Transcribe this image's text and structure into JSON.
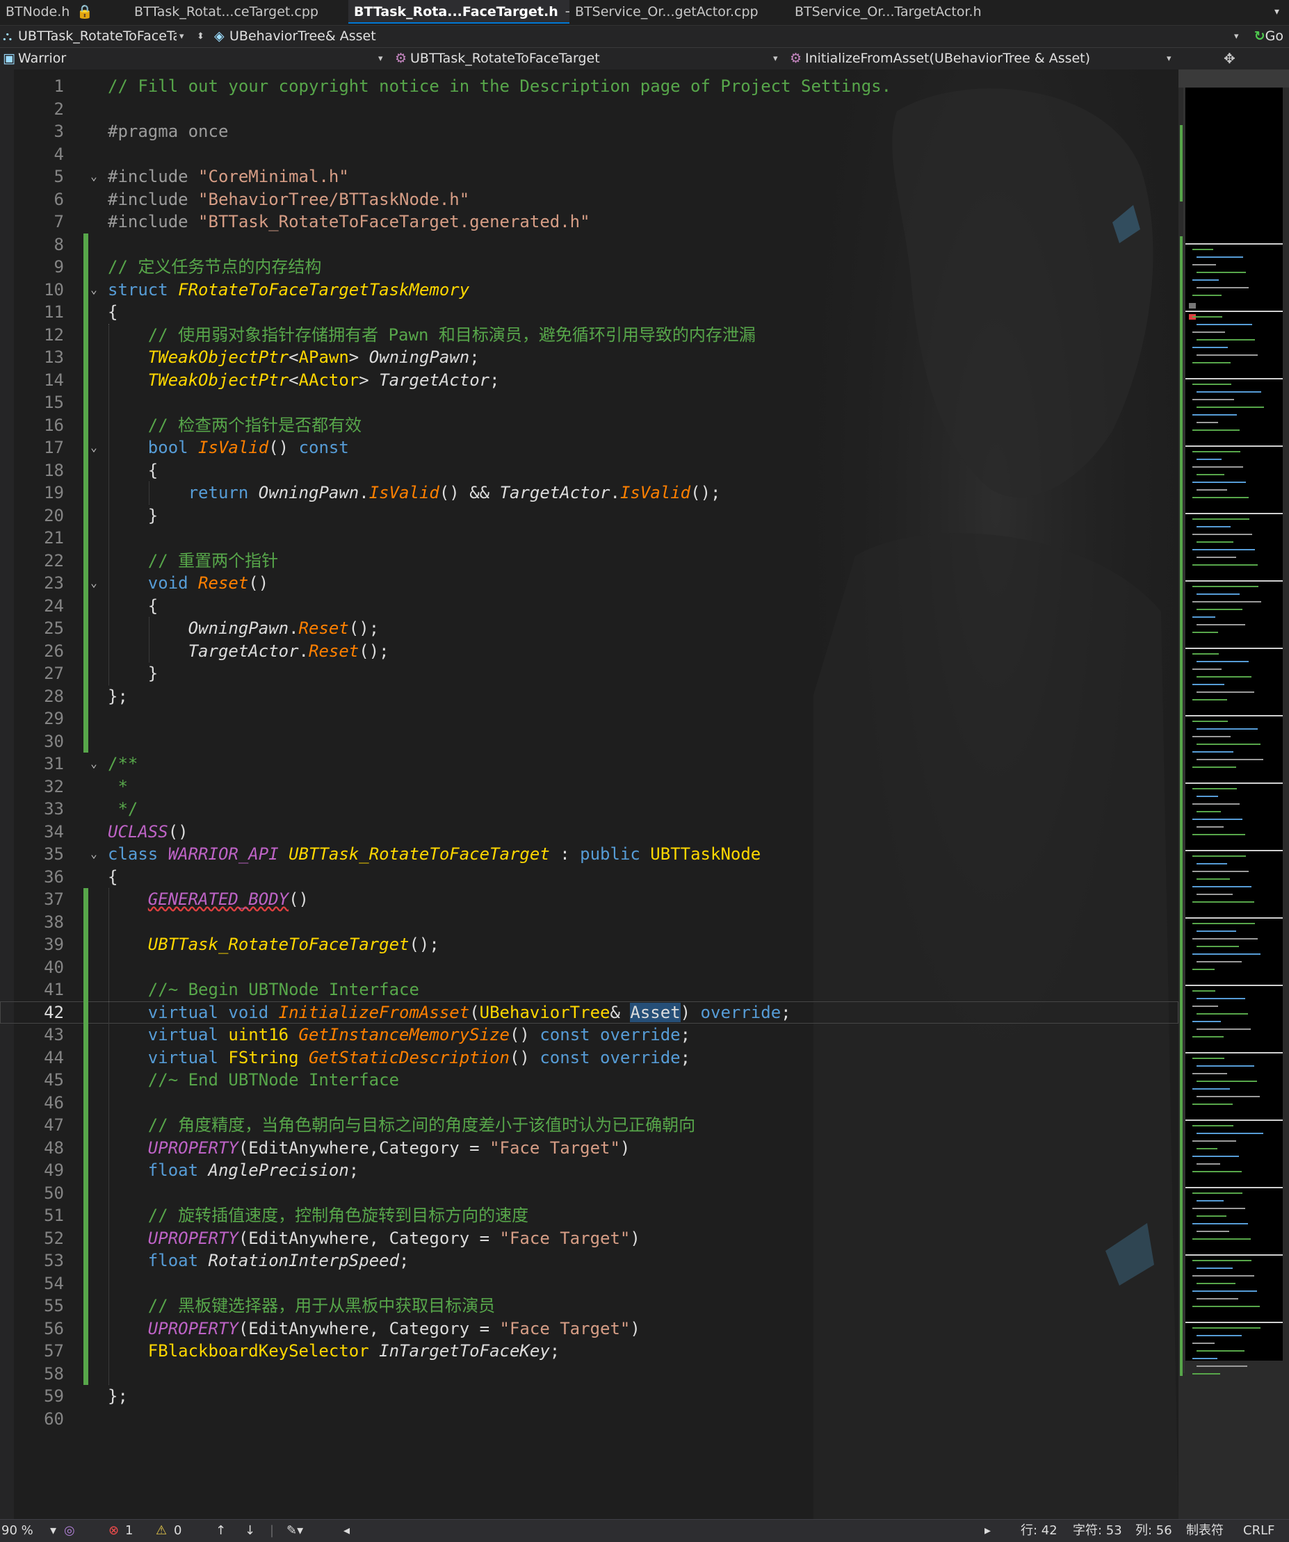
{
  "tabs": [
    {
      "label": "BTNode.h",
      "glyph": "🔒"
    },
    {
      "label": "BTTask_Rotat...ceTarget.cpp",
      "glyph": ""
    },
    {
      "label": "BTTask_Rota...FaceTarget.h",
      "glyph": "⊸  ✕"
    },
    {
      "label": "BTService_Or...getActor.cpp",
      "glyph": ""
    },
    {
      "label": "BTService_Or...TargetActor.h",
      "glyph": ""
    }
  ],
  "tab_overflow_glyph": "▾",
  "nav1": {
    "left_icon": "⛬",
    "left_label": "UBTTask_RotateToFaceTa",
    "left_dd": "▾",
    "updown": "⬍",
    "middle_icon": "◈",
    "middle_label": "UBehaviorTree& Asset",
    "right_dd": "▾",
    "go_glyph": "↻",
    "go_label": "Go"
  },
  "nav2": {
    "project_icon": "▣",
    "project": "Warrior",
    "dd1": "▾",
    "scope_icon": "⚙",
    "scope": "UBTTask_RotateToFaceTarget",
    "dd2": "▾",
    "member_icon": "⚙",
    "member": "InitializeFromAsset(UBehaviorTree & Asset)",
    "dd3": "▾",
    "split_glyph": "✥"
  },
  "code_lines": [
    [
      [
        "cm",
        "// Fill out your copyright notice in the Description page of Project Settings."
      ]
    ],
    [],
    [
      [
        "pp",
        "#pragma once"
      ]
    ],
    [],
    [
      [
        "pp",
        "#include "
      ],
      [
        "str",
        "\"CoreMinimal.h\""
      ]
    ],
    [
      [
        "pp",
        "#include "
      ],
      [
        "str",
        "\"BehaviorTree/BTTaskNode.h\""
      ]
    ],
    [
      [
        "pp",
        "#include "
      ],
      [
        "str",
        "\"BTTask_RotateToFaceTarget.generated.h\""
      ]
    ],
    [],
    [
      [
        "cm",
        "// 定义任务节点的内存结构"
      ]
    ],
    [
      [
        "kw",
        "struct "
      ],
      [
        "ty",
        "FRotateToFaceTargetTaskMemory"
      ]
    ],
    [
      [
        "pl",
        "{"
      ]
    ],
    [
      [
        "pl",
        "    "
      ],
      [
        "cm",
        "// 使用弱对象指针存储拥有者 Pawn 和目标演员，避免循环引用导致的内存泄漏"
      ]
    ],
    [
      [
        "pl",
        "    "
      ],
      [
        "ty",
        "TWeakObjectPtr"
      ],
      [
        "pl",
        "<"
      ],
      [
        "tyn",
        "APawn"
      ],
      [
        "pl",
        "> "
      ],
      [
        "va",
        "OwningPawn"
      ],
      [
        "pl",
        ";"
      ]
    ],
    [
      [
        "pl",
        "    "
      ],
      [
        "ty",
        "TWeakObjectPtr"
      ],
      [
        "pl",
        "<"
      ],
      [
        "tyn",
        "AActor"
      ],
      [
        "pl",
        "> "
      ],
      [
        "va",
        "TargetActor"
      ],
      [
        "pl",
        ";"
      ]
    ],
    [],
    [
      [
        "pl",
        "    "
      ],
      [
        "cm",
        "// 检查两个指针是否都有效"
      ]
    ],
    [
      [
        "pl",
        "    "
      ],
      [
        "kw",
        "bool "
      ],
      [
        "fn",
        "IsValid"
      ],
      [
        "pl",
        "() "
      ],
      [
        "kw",
        "const"
      ]
    ],
    [
      [
        "pl",
        "    {"
      ]
    ],
    [
      [
        "pl",
        "        "
      ],
      [
        "kw",
        "return "
      ],
      [
        "va",
        "OwningPawn"
      ],
      [
        "pl",
        "."
      ],
      [
        "fn",
        "IsValid"
      ],
      [
        "pl",
        "() && "
      ],
      [
        "va",
        "TargetActor"
      ],
      [
        "pl",
        "."
      ],
      [
        "fn",
        "IsValid"
      ],
      [
        "pl",
        "();"
      ]
    ],
    [
      [
        "pl",
        "    }"
      ]
    ],
    [],
    [
      [
        "pl",
        "    "
      ],
      [
        "cm",
        "// 重置两个指针"
      ]
    ],
    [
      [
        "pl",
        "    "
      ],
      [
        "kw",
        "void "
      ],
      [
        "fn",
        "Reset"
      ],
      [
        "pl",
        "()"
      ]
    ],
    [
      [
        "pl",
        "    {"
      ]
    ],
    [
      [
        "pl",
        "        "
      ],
      [
        "va",
        "OwningPawn"
      ],
      [
        "pl",
        "."
      ],
      [
        "fn",
        "Reset"
      ],
      [
        "pl",
        "();"
      ]
    ],
    [
      [
        "pl",
        "        "
      ],
      [
        "va",
        "TargetActor"
      ],
      [
        "pl",
        "."
      ],
      [
        "fn",
        "Reset"
      ],
      [
        "pl",
        "();"
      ]
    ],
    [
      [
        "pl",
        "    }"
      ]
    ],
    [
      [
        "pl",
        "};"
      ]
    ],
    [],
    [],
    [
      [
        "cm",
        "/**"
      ]
    ],
    [
      [
        "cm",
        " *"
      ]
    ],
    [
      [
        "cm",
        " */"
      ]
    ],
    [
      [
        "mac",
        "UCLASS"
      ],
      [
        "pl",
        "()"
      ]
    ],
    [
      [
        "kw",
        "class "
      ],
      [
        "mac",
        "WARRIOR_API "
      ],
      [
        "ty",
        "UBTTask_RotateToFaceTarget"
      ],
      [
        "pl",
        " : "
      ],
      [
        "kw",
        "public "
      ],
      [
        "tyn",
        "UBTTaskNode"
      ]
    ],
    [
      [
        "pl",
        "{"
      ]
    ],
    [
      [
        "pl",
        "    "
      ],
      [
        "mac",
        "GENERATED_BODY"
      ],
      [
        "pl",
        "()"
      ]
    ],
    [],
    [
      [
        "pl",
        "    "
      ],
      [
        "ty",
        "UBTTask_RotateToFaceTarget"
      ],
      [
        "pl",
        "();"
      ]
    ],
    [],
    [
      [
        "pl",
        "    "
      ],
      [
        "cm",
        "//~ Begin UBTNode Interface"
      ]
    ],
    [
      [
        "pl",
        "    "
      ],
      [
        "kw",
        "virtual void "
      ],
      [
        "fn",
        "InitializeFromAsset"
      ],
      [
        "pl",
        "("
      ],
      [
        "tyn",
        "UBehaviorTree"
      ],
      [
        "pl",
        "& "
      ],
      [
        "sel",
        "Asset"
      ],
      [
        "pl",
        ") "
      ],
      [
        "kw",
        "override"
      ],
      [
        "pl",
        ";"
      ]
    ],
    [
      [
        "pl",
        "    "
      ],
      [
        "kw",
        "virtual "
      ],
      [
        "tyn",
        "uint16 "
      ],
      [
        "fn",
        "GetInstanceMemorySize"
      ],
      [
        "pl",
        "() "
      ],
      [
        "kw",
        "const override"
      ],
      [
        "pl",
        ";"
      ]
    ],
    [
      [
        "pl",
        "    "
      ],
      [
        "kw",
        "virtual "
      ],
      [
        "tyn",
        "FString "
      ],
      [
        "fn",
        "GetStaticDescription"
      ],
      [
        "pl",
        "() "
      ],
      [
        "kw",
        "const override"
      ],
      [
        "pl",
        ";"
      ]
    ],
    [
      [
        "pl",
        "    "
      ],
      [
        "cm",
        "//~ End UBTNode Interface"
      ]
    ],
    [],
    [
      [
        "pl",
        "    "
      ],
      [
        "cm",
        "// 角度精度，当角色朝向与目标之间的角度差小于该值时认为已正确朝向"
      ]
    ],
    [
      [
        "pl",
        "    "
      ],
      [
        "mac",
        "UPROPERTY"
      ],
      [
        "pl",
        "(EditAnywhere,Category = "
      ],
      [
        "str",
        "\"Face Target\""
      ],
      [
        "pl",
        ")"
      ]
    ],
    [
      [
        "pl",
        "    "
      ],
      [
        "kw",
        "float "
      ],
      [
        "va",
        "AnglePrecision"
      ],
      [
        "pl",
        ";"
      ]
    ],
    [],
    [
      [
        "pl",
        "    "
      ],
      [
        "cm",
        "// 旋转插值速度，控制角色旋转到目标方向的速度"
      ]
    ],
    [
      [
        "pl",
        "    "
      ],
      [
        "mac",
        "UPROPERTY"
      ],
      [
        "pl",
        "(EditAnywhere, Category = "
      ],
      [
        "str",
        "\"Face Target\""
      ],
      [
        "pl",
        ")"
      ]
    ],
    [
      [
        "pl",
        "    "
      ],
      [
        "kw",
        "float "
      ],
      [
        "va",
        "RotationInterpSpeed"
      ],
      [
        "pl",
        ";"
      ]
    ],
    [],
    [
      [
        "pl",
        "    "
      ],
      [
        "cm",
        "// 黑板键选择器，用于从黑板中获取目标演员"
      ]
    ],
    [
      [
        "pl",
        "    "
      ],
      [
        "mac",
        "UPROPERTY"
      ],
      [
        "pl",
        "(EditAnywhere, Category = "
      ],
      [
        "str",
        "\"Face Target\""
      ],
      [
        "pl",
        ")"
      ]
    ],
    [
      [
        "pl",
        "    "
      ],
      [
        "tyn",
        "FBlackboardKeySelector "
      ],
      [
        "va",
        "InTargetToFaceKey"
      ],
      [
        "pl",
        ";"
      ]
    ],
    [],
    [
      [
        "pl",
        "};"
      ]
    ],
    []
  ],
  "current_line": 42,
  "fold_lines": [
    5,
    10,
    17,
    23,
    31,
    35
  ],
  "fold_glyph": "⌄",
  "status": {
    "zoom": "90 %",
    "zoom_dd": "▾",
    "health_icon": "◎",
    "error_glyph": "⊗",
    "errors": "1",
    "warning_glyph": "⚠",
    "warnings": "0",
    "prev_glyph": "↑",
    "next_glyph": "↓",
    "sep": "|",
    "brush_glyph": "✎▾",
    "scroll_left": "◂",
    "scroll_right": "▸",
    "line": "行: 42",
    "char": "字符: 53",
    "col": "列: 56",
    "tabs": "制表符",
    "eol": "CRLF"
  },
  "colors": {
    "comment": "#57a64a",
    "keyword": "#569cd6",
    "string": "#d69d85",
    "type": "#ffd700",
    "function": "#ff8000",
    "macro": "#bd63c5",
    "change_bar": "#57a64a",
    "accent": "#0078d4"
  }
}
